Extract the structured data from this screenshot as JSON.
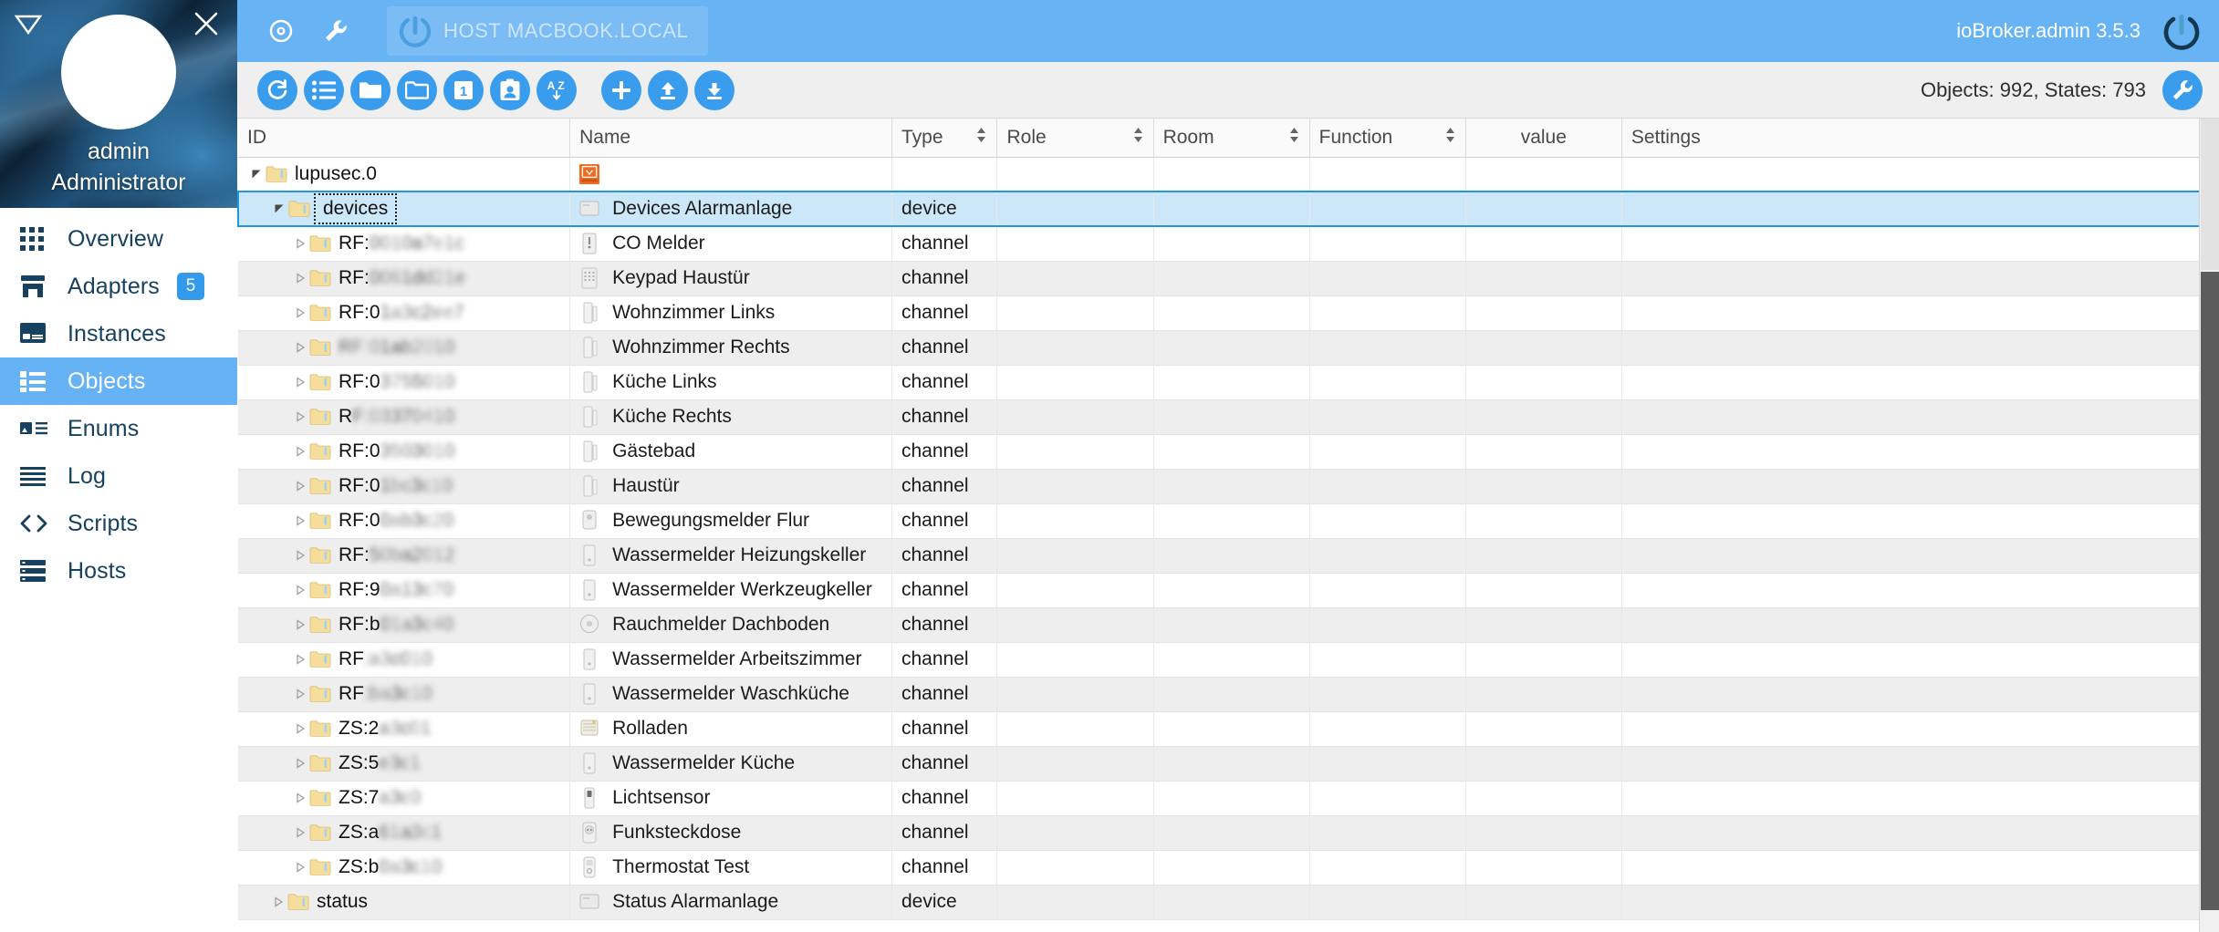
{
  "sidebar": {
    "user": {
      "name": "admin",
      "role": "Administrator"
    },
    "collapse_icon": "collapse-triangle-icon",
    "close_icon": "close-icon",
    "items": [
      {
        "label": "Overview",
        "icon": "grid-icon",
        "active": false,
        "badge": ""
      },
      {
        "label": "Adapters",
        "icon": "store-icon",
        "active": false,
        "badge": "5"
      },
      {
        "label": "Instances",
        "icon": "card-icon",
        "active": false,
        "badge": ""
      },
      {
        "label": "Objects",
        "icon": "list-icon",
        "active": true,
        "badge": ""
      },
      {
        "label": "Enums",
        "icon": "enum-icon",
        "active": false,
        "badge": ""
      },
      {
        "label": "Log",
        "icon": "lines-icon",
        "active": false,
        "badge": ""
      },
      {
        "label": "Scripts",
        "icon": "code-icon",
        "active": false,
        "badge": ""
      },
      {
        "label": "Hosts",
        "icon": "server-icon",
        "active": false,
        "badge": ""
      }
    ]
  },
  "topbar": {
    "eye_icon": "eye-icon",
    "wrench_icon": "wrench-icon",
    "host_chip": {
      "label": "HOST MACBOOK.LOCAL",
      "logo": "iobroker-logo-icon"
    },
    "version": "ioBroker.admin 3.5.3",
    "brand_logo": "iobroker-logo-icon",
    "accent_color": "#68b3f4"
  },
  "toolbar": {
    "buttons": [
      {
        "name": "refresh-button",
        "icon": "refresh-icon"
      },
      {
        "name": "expand-list-button",
        "icon": "list-icon"
      },
      {
        "name": "expand-all-button",
        "icon": "folder-filled-icon"
      },
      {
        "name": "collapse-all-button",
        "icon": "folder-open-icon"
      },
      {
        "name": "expand-one-level-button",
        "icon": "number-one-icon"
      },
      {
        "name": "show-instance-button",
        "icon": "id-card-icon"
      },
      {
        "name": "sort-alpha-button",
        "icon": "sort-az-icon"
      },
      {
        "name": "add-object-button",
        "icon": "plus-icon"
      },
      {
        "name": "import-button",
        "icon": "upload-icon"
      },
      {
        "name": "export-button",
        "icon": "download-icon"
      }
    ],
    "counts": "Objects: 992, States: 793",
    "settings_icon": "wrench-icon",
    "button_color": "#3a9ced"
  },
  "table": {
    "columns": [
      "ID",
      "Name",
      "Type",
      "Role",
      "Room",
      "Function",
      "value",
      "Settings"
    ],
    "sortable": [
      false,
      false,
      true,
      true,
      true,
      true,
      false,
      false
    ],
    "rows": [
      {
        "indent": 0,
        "expander": "expanded",
        "id_prefix": "lupusec.0",
        "id_blur": "",
        "name": "",
        "type": "",
        "icon": "adapter-logo",
        "selected": false,
        "edit": false,
        "focus": false
      },
      {
        "indent": 1,
        "expander": "expanded",
        "id_prefix": "devices",
        "id_blur": "",
        "name": "Devices Alarmanlage",
        "type": "device",
        "icon": "panel",
        "selected": true,
        "edit": true,
        "focus": true
      },
      {
        "indent": 2,
        "expander": "collapsed",
        "id_prefix": "RF:",
        "id_blur": "0010a7e1c",
        "name": "CO Melder",
        "type": "channel",
        "icon": "detector",
        "selected": false,
        "edit": true,
        "focus": false
      },
      {
        "indent": 2,
        "expander": "collapsed",
        "id_prefix": "RF:",
        "id_blur": "0061dd21e",
        "name": "Keypad Haustür",
        "type": "channel",
        "icon": "keypad",
        "selected": false,
        "edit": true,
        "focus": false
      },
      {
        "indent": 2,
        "expander": "collapsed",
        "id_prefix": "RF:0",
        "id_blur": "1a3c2ee7",
        "name": "Wohnzimmer Links",
        "type": "channel",
        "icon": "contact",
        "selected": false,
        "edit": true,
        "focus": false
      },
      {
        "indent": 2,
        "expander": "collapsed",
        "id_prefix": "",
        "id_blur": "RF:01ab2010",
        "name": "Wohnzimmer Rechts",
        "type": "channel",
        "icon": "contact",
        "selected": false,
        "edit": true,
        "focus": false
      },
      {
        "indent": 2,
        "expander": "collapsed",
        "id_prefix": "RF:0",
        "id_blur": "3755010",
        "name": "Küche Links",
        "type": "channel",
        "icon": "contact",
        "selected": false,
        "edit": true,
        "focus": false
      },
      {
        "indent": 2,
        "expander": "collapsed",
        "id_prefix": "R",
        "id_blur": "F:03370410",
        "name": "Küche Rechts",
        "type": "channel",
        "icon": "contact",
        "selected": false,
        "edit": true,
        "focus": false
      },
      {
        "indent": 2,
        "expander": "collapsed",
        "id_prefix": "RF:0",
        "id_blur": "3503010",
        "name": "Gästebad",
        "type": "channel",
        "icon": "contact",
        "selected": false,
        "edit": true,
        "focus": false
      },
      {
        "indent": 2,
        "expander": "collapsed",
        "id_prefix": "RF:0",
        "id_blur": "1bc3c10",
        "name": "Haustür",
        "type": "channel",
        "icon": "contact",
        "selected": false,
        "edit": true,
        "focus": false
      },
      {
        "indent": 2,
        "expander": "collapsed",
        "id_prefix": "RF:0",
        "id_blur": "0ab3c20",
        "name": "Bewegungsmelder Flur",
        "type": "channel",
        "icon": "motion",
        "selected": false,
        "edit": true,
        "focus": false
      },
      {
        "indent": 2,
        "expander": "collapsed",
        "id_prefix": "RF:",
        "id_blur": "50ba2012",
        "name": "Wassermelder Heizungskeller",
        "type": "channel",
        "icon": "water",
        "selected": false,
        "edit": true,
        "focus": false
      },
      {
        "indent": 2,
        "expander": "collapsed",
        "id_prefix": "RF:9",
        "id_blur": "0a13c70",
        "name": "Wassermelder Werkzeugkeller",
        "type": "channel",
        "icon": "water",
        "selected": false,
        "edit": true,
        "focus": false
      },
      {
        "indent": 2,
        "expander": "collapsed",
        "id_prefix": "RF:b",
        "id_blur": "01a3c40",
        "name": "Rauchmelder Dachboden",
        "type": "channel",
        "icon": "smoke",
        "selected": false,
        "edit": true,
        "focus": false
      },
      {
        "indent": 2,
        "expander": "collapsed",
        "id_prefix": "RF",
        "id_blur": ":a3c010",
        "name": "Wassermelder Arbeitszimmer",
        "type": "channel",
        "icon": "water",
        "selected": false,
        "edit": true,
        "focus": false
      },
      {
        "indent": 2,
        "expander": "collapsed",
        "id_prefix": "RF",
        "id_blur": ":ba3c10",
        "name": "Wassermelder Waschküche",
        "type": "channel",
        "icon": "water",
        "selected": false,
        "edit": true,
        "focus": false
      },
      {
        "indent": 2,
        "expander": "collapsed",
        "id_prefix": "ZS:2",
        "id_blur": "a3c01",
        "name": "Rolladen",
        "type": "channel",
        "icon": "shutter",
        "selected": false,
        "edit": true,
        "focus": false
      },
      {
        "indent": 2,
        "expander": "collapsed",
        "id_prefix": "ZS:5",
        "id_blur": "e3c1",
        "name": "Wassermelder Küche",
        "type": "channel",
        "icon": "water",
        "selected": false,
        "edit": true,
        "focus": false
      },
      {
        "indent": 2,
        "expander": "collapsed",
        "id_prefix": "ZS:7",
        "id_blur": "a3c0",
        "name": "Lichtsensor",
        "type": "channel",
        "icon": "light",
        "selected": false,
        "edit": true,
        "focus": false
      },
      {
        "indent": 2,
        "expander": "collapsed",
        "id_prefix": "ZS:a",
        "id_blur": "61a3c1",
        "name": "Funksteckdose",
        "type": "channel",
        "icon": "plug",
        "selected": false,
        "edit": true,
        "focus": false
      },
      {
        "indent": 2,
        "expander": "collapsed",
        "id_prefix": "ZS:b",
        "id_blur": "0a3c10",
        "name": "Thermostat Test",
        "type": "channel",
        "icon": "thermostat",
        "selected": false,
        "edit": true,
        "focus": false
      },
      {
        "indent": 1,
        "expander": "collapsed",
        "id_prefix": "status",
        "id_blur": "",
        "name": "Status Alarmanlage",
        "type": "device",
        "icon": "panel",
        "selected": false,
        "edit": true,
        "focus": false
      }
    ]
  }
}
